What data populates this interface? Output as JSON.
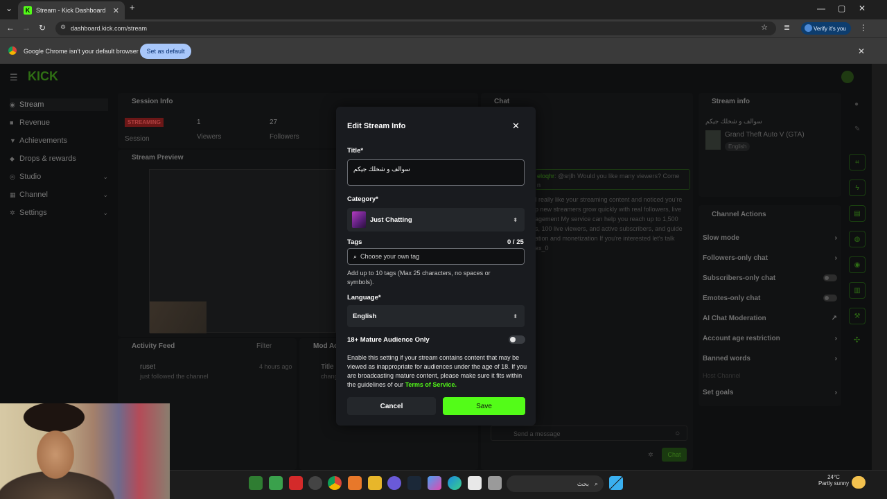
{
  "browser": {
    "tab_title": "Stream - Kick Dashboard",
    "url": "dashboard.kick.com/stream",
    "verify_label": "Verify it's you",
    "infobar_message": "Google Chrome isn't your default browser",
    "set_default_label": "Set as default"
  },
  "dashboard": {
    "logo": "KICK",
    "sidebar": [
      {
        "label": "Stream",
        "icon": "broadcast-icon"
      },
      {
        "label": "Revenue",
        "icon": "revenue-icon"
      },
      {
        "label": "Achievements",
        "icon": "trophy-icon"
      },
      {
        "label": "Drops & rewards",
        "icon": "gift-icon"
      },
      {
        "label": "Studio",
        "icon": "studio-icon"
      },
      {
        "label": "Channel",
        "icon": "channel-icon"
      },
      {
        "label": "Settings",
        "icon": "gear-icon"
      }
    ],
    "session_info": {
      "heading": "Session Info",
      "status": "STREAMING",
      "status_label": "Session",
      "viewers_value": "1",
      "viewers_label": "Viewers",
      "followers_value": "27",
      "followers_label": "Followers"
    },
    "stream_preview": {
      "heading": "Stream Preview"
    },
    "activity_feed": {
      "heading": "Activity Feed",
      "filter_label": "Filter",
      "user": "ruset",
      "action": "just followed the channel",
      "time": "4 hours ago"
    },
    "mod_actions": {
      "heading": "Mod Ac",
      "item_title": "Title",
      "item_sub": "chang"
    },
    "chat": {
      "heading": "Chat",
      "msg_user": "eloqhr",
      "msg_line1": ": @srjlh Would you like many viewers? Come",
      "msg_line2": "n",
      "spam_lines": [
        "I really like your streaming content and noticed you're",
        "p new streamers grow quickly with real followers, live",
        "agement My service can help you reach up to 1,500",
        "s, 100 live viewers, and active subscribers, and guide",
        "ation and monetization If you're interested let's talk",
        "ex_0"
      ],
      "input_placeholder": "Send a message",
      "chat_button": "Chat",
      "muted_label": "Host Channel"
    },
    "stream_info": {
      "heading": "Stream info",
      "title": "سوالف و شخلك جيكم",
      "game": "Grand Theft Auto V (GTA)",
      "language_tag": "English"
    },
    "channel_actions": {
      "heading": "Channel Actions",
      "items": [
        "Slow mode",
        "Followers-only chat",
        "Subscribers-only chat",
        "Emotes-only chat",
        "AI Chat Moderation",
        "Account age restriction",
        "Banned words",
        "Set goals"
      ]
    }
  },
  "modal": {
    "title": "Edit Stream Info",
    "title_label": "Title*",
    "title_value": "سوالف و شخلك جيكم",
    "category_label": "Category*",
    "category_value": "Just Chatting",
    "tags_label": "Tags",
    "tags_count": "0 / 25",
    "tags_placeholder": "Choose your own tag",
    "tags_help": "Add up to 10 tags (Max 25 characters, no spaces or symbols).",
    "language_label": "Language*",
    "language_value": "English",
    "mature_label": "18+ Mature Audience Only",
    "mature_help": "Enable this setting if your stream contains content that may be viewed as inappropriate for audiences under the age of 18. If you are broadcasting mature content, please make sure it fits within the guidelines of our",
    "tos_link": "Terms of Service.",
    "cancel_label": "Cancel",
    "save_label": "Save"
  },
  "taskbar": {
    "search_text": "بحث",
    "temperature": "24°C",
    "weather": "Partly sunny"
  },
  "colors": {
    "accent": "#53fc18",
    "modal_bg": "#191b1f",
    "live_red": "#6b1717"
  }
}
